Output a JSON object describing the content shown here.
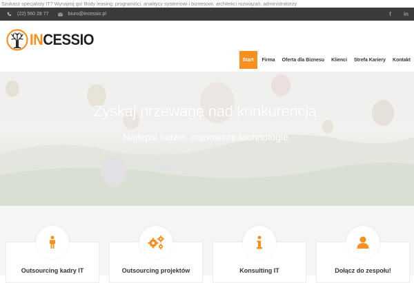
{
  "tagline": "Szukasz specjalisty IT? Wynajmij go! Body leasing: programiści, analitycy systemowi i biznesowi, architekci rozwiązań, administratorzy",
  "topbar": {
    "phone": "(22) 560 28 77",
    "email": "biuro@incessio.pl",
    "social": [
      {
        "name": "facebook",
        "glyph": "f"
      },
      {
        "name": "linkedin",
        "glyph": "in"
      }
    ]
  },
  "logo": {
    "prefix": "IN",
    "rest": "CESSIO"
  },
  "nav": [
    {
      "label": "Start",
      "active": true
    },
    {
      "label": "Firma",
      "active": false
    },
    {
      "label": "Oferta dla Biznesu",
      "active": false
    },
    {
      "label": "Klienci",
      "active": false
    },
    {
      "label": "Strefa Kariery",
      "active": false
    },
    {
      "label": "Kontakt",
      "active": false
    }
  ],
  "hero": {
    "title": "Zyskaj przewagę nad konkurencją.",
    "subtitle": "Najlepsi ludzie, najnowsze technologie."
  },
  "services": [
    {
      "label": "Outsourcing kadry IT",
      "icon": "person-icon"
    },
    {
      "label": "Outsourcing projektów",
      "icon": "gears-icon"
    },
    {
      "label": "Konsulting IT",
      "icon": "info-icon"
    },
    {
      "label": "Dołącz do zespołu!",
      "icon": "user-icon"
    }
  ],
  "colors": {
    "accent": "#f7901e",
    "topbar": "#3b3b3b",
    "text": "#333333"
  }
}
